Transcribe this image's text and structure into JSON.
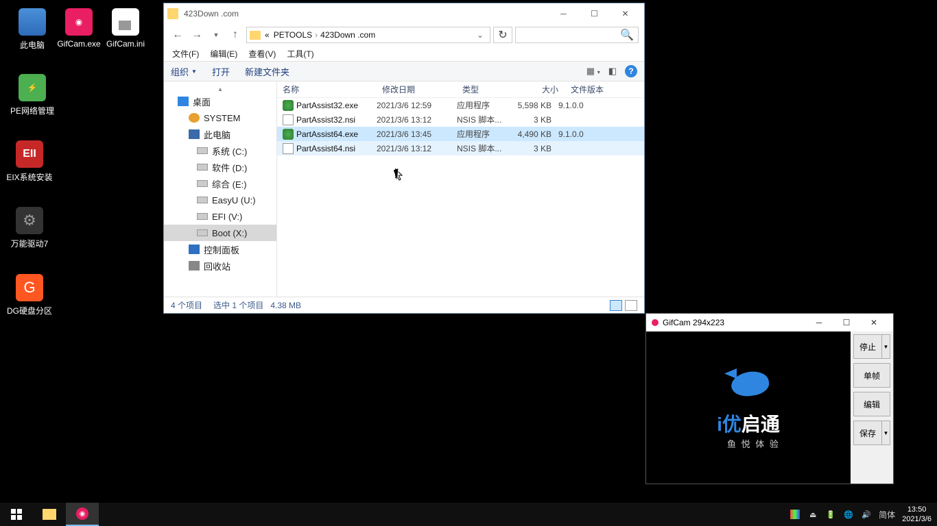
{
  "desktop": {
    "icons": [
      {
        "label": "此电脑",
        "cls": "ic-pc"
      },
      {
        "label": "GifCam.exe",
        "cls": "ic-red"
      },
      {
        "label": "GifCam.ini",
        "cls": "ic-ini"
      },
      {
        "label": "PE网络管理",
        "cls": "ic-green"
      },
      {
        "label": "EIX系统安装",
        "cls": "ic-darkred",
        "glyph": "EII"
      },
      {
        "label": "万能驱动7",
        "cls": "ic-gear",
        "glyph": "⚙"
      },
      {
        "label": "DG硬盘分区",
        "cls": "ic-orange",
        "glyph": "G"
      }
    ]
  },
  "explorer": {
    "title": "423Down .com",
    "breadcrumb": {
      "root": "«",
      "p1": "PETOOLS",
      "p2": "423Down .com"
    },
    "menu": {
      "file": "文件(F)",
      "edit": "编辑(E)",
      "view": "查看(V)",
      "tools": "工具(T)"
    },
    "toolbar": {
      "org": "组织",
      "open": "打开",
      "newf": "新建文件夹"
    },
    "cols": {
      "name": "名称",
      "date": "修改日期",
      "type": "类型",
      "size": "大小",
      "ver": "文件版本"
    },
    "nav": {
      "desktop": "桌面",
      "system": "SYSTEM",
      "pc": "此电脑",
      "drives": [
        {
          "label": "系统 (C:)"
        },
        {
          "label": "软件 (D:)"
        },
        {
          "label": "综合 (E:)"
        },
        {
          "label": "EasyU (U:)"
        },
        {
          "label": "EFI (V:)"
        },
        {
          "label": "Boot (X:)"
        }
      ],
      "cp": "控制面板",
      "bin": "回收站"
    },
    "files": [
      {
        "name": "PartAssist32.exe",
        "date": "2021/3/6 12:59",
        "type": "应用程序",
        "size": "5,598 KB",
        "ver": "9.1.0.0",
        "ic": "ic-exe"
      },
      {
        "name": "PartAssist32.nsi",
        "date": "2021/3/6 13:12",
        "type": "NSIS 脚本...",
        "size": "3 KB",
        "ver": "",
        "ic": "ic-nsi"
      },
      {
        "name": "PartAssist64.exe",
        "date": "2021/3/6 13:45",
        "type": "应用程序",
        "size": "4,490 KB",
        "ver": "9.1.0.0",
        "ic": "ic-exe"
      },
      {
        "name": "PartAssist64.nsi",
        "date": "2021/3/6 13:12",
        "type": "NSIS 脚本...",
        "size": "3 KB",
        "ver": "",
        "ic": "ic-nsi"
      }
    ],
    "status": {
      "count": "4 个项目",
      "sel": "选中 1 个项目",
      "size": "4.38 MB"
    }
  },
  "gifcam": {
    "title": "GifCam 294x223",
    "logo1a": "i优",
    "logo1b": "启通",
    "logo2": "鱼 悦 体 验",
    "btns": {
      "stop": "停止",
      "frame": "单帧",
      "edit": "编辑",
      "save": "保存"
    }
  },
  "taskbar": {
    "lang": "简体",
    "time": "13:50",
    "date": "2021/3/6"
  }
}
